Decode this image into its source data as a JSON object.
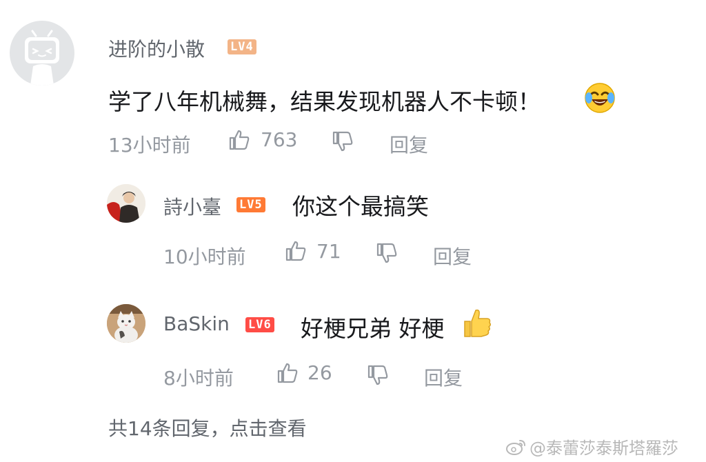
{
  "comment": {
    "username": "进阶的小散",
    "level": "LV4",
    "text": "学了八年机械舞，结果发现机器人不卡顿！",
    "emoji": "laughing-crying-emoji",
    "time": "13小时前",
    "likes": "763",
    "reply_label": "回复"
  },
  "replies": [
    {
      "username": "詩小臺",
      "level": "LV5",
      "text": "你这个最搞笑",
      "time": "10小时前",
      "likes": "71",
      "reply_label": "回复"
    },
    {
      "username": "BaSkin",
      "level": "LV6",
      "text": "好梗兄弟 好梗",
      "emoji": "thumbs-up-emoji",
      "time": "8小时前",
      "likes": "26",
      "reply_label": "回复"
    }
  ],
  "footer": {
    "view_replies": "共14条回复，点击查看"
  },
  "watermark": "@泰蕾莎泰斯塔羅莎",
  "colors": {
    "lv4": "#f3b487",
    "lv5": "#ff7a35",
    "lv6": "#ff4d46",
    "meta": "#9499a0",
    "username": "#61666d"
  }
}
